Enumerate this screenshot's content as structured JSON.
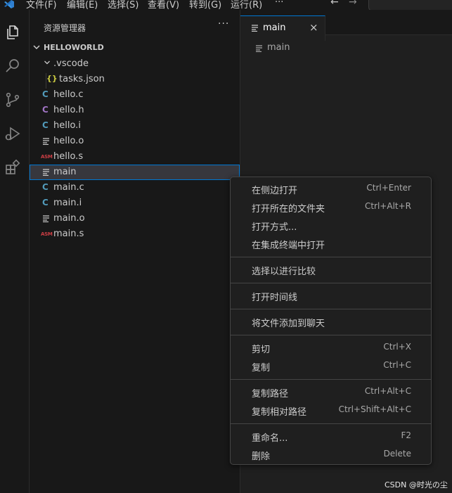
{
  "menubar": {
    "items": [
      "文件(F)",
      "编辑(E)",
      "选择(S)",
      "查看(V)",
      "转到(G)",
      "运行(R)"
    ],
    "more": "···"
  },
  "sidebar": {
    "title": "资源管理器",
    "more": "···",
    "section": "HELLOWORLD",
    "tree": [
      {
        "label": ".vscode",
        "icon": "folder-chevron-icon"
      },
      {
        "label": "tasks.json",
        "icon": "json-braces-icon",
        "glyph": "{}"
      },
      {
        "label": "hello.c",
        "icon": "c-file-icon",
        "glyph": "C"
      },
      {
        "label": "hello.h",
        "icon": "c-header-icon",
        "glyph": "C"
      },
      {
        "label": "hello.i",
        "icon": "c-file-icon",
        "glyph": "C"
      },
      {
        "label": "hello.o",
        "icon": "lines-file-icon"
      },
      {
        "label": "hello.s",
        "icon": "asm-file-icon",
        "glyph": "ASM"
      },
      {
        "label": "main",
        "icon": "lines-file-icon",
        "selected": true
      },
      {
        "label": "main.c",
        "icon": "c-file-icon",
        "glyph": "C"
      },
      {
        "label": "main.i",
        "icon": "c-file-icon",
        "glyph": "C"
      },
      {
        "label": "main.o",
        "icon": "lines-file-icon"
      },
      {
        "label": "main.s",
        "icon": "asm-file-icon",
        "glyph": "ASM"
      }
    ]
  },
  "editor": {
    "tab": {
      "label": "main",
      "close": "×"
    },
    "breadcrumb": "main"
  },
  "context_menu": {
    "items": [
      {
        "label": "在侧边打开",
        "shortcut": "Ctrl+Enter"
      },
      {
        "label": "打开所在的文件夹",
        "shortcut": "Ctrl+Alt+R"
      },
      {
        "label": "打开方式...",
        "shortcut": ""
      },
      {
        "label": "在集成终端中打开",
        "shortcut": ""
      },
      {
        "label": "选择以进行比较",
        "shortcut": ""
      },
      {
        "label": "打开时间线",
        "shortcut": ""
      },
      {
        "label": "将文件添加到聊天",
        "shortcut": ""
      },
      {
        "label": "剪切",
        "shortcut": "Ctrl+X"
      },
      {
        "label": "复制",
        "shortcut": "Ctrl+C"
      },
      {
        "label": "复制路径",
        "shortcut": "Ctrl+Alt+C"
      },
      {
        "label": "复制相对路径",
        "shortcut": "Ctrl+Shift+Alt+C"
      },
      {
        "label": "重命名...",
        "shortcut": "F2"
      },
      {
        "label": "删除",
        "shortcut": "Delete"
      }
    ]
  },
  "watermark": "CSDN @时光の尘",
  "colors": {
    "accent": "#0078d4",
    "c_file": "#519aba",
    "h_file": "#a074c4",
    "json": "#cbcb41",
    "asm": "#cc3e44"
  }
}
